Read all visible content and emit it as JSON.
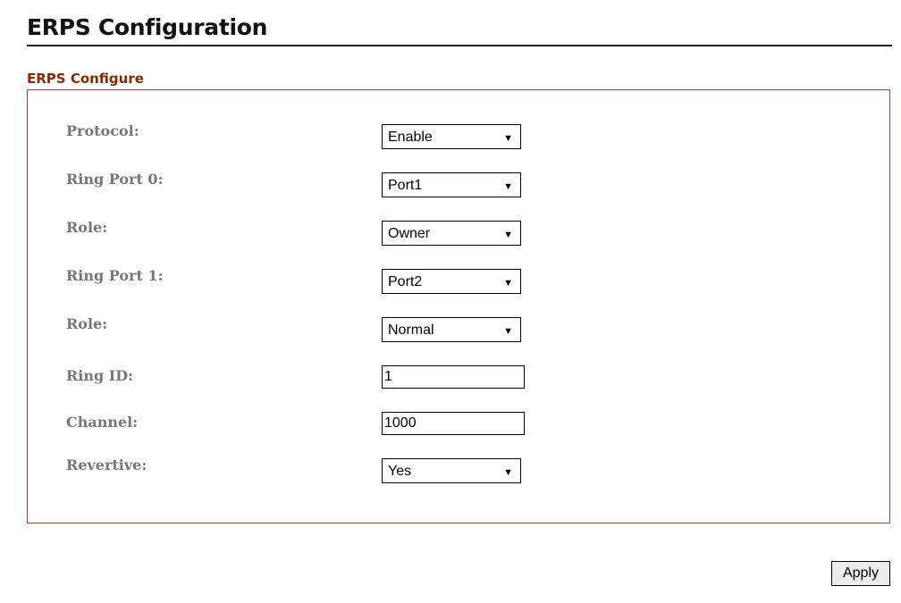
{
  "page": {
    "title": "ERPS Configuration"
  },
  "section": {
    "title": "ERPS Configure"
  },
  "form": {
    "protocol": {
      "label": "Protocol:",
      "value": "Enable",
      "icon": "dropdown-arrow-icon"
    },
    "ring_port_0": {
      "label": "Ring Port 0:",
      "value": "Port1",
      "icon": "dropdown-arrow-icon"
    },
    "role_0": {
      "label": "Role:",
      "value": "Owner",
      "icon": "dropdown-arrow-icon"
    },
    "ring_port_1": {
      "label": "Ring Port 1:",
      "value": "Port2",
      "icon": "dropdown-arrow-icon"
    },
    "role_1": {
      "label": "Role:",
      "value": "Normal",
      "icon": "dropdown-arrow-icon"
    },
    "ring_id": {
      "label": "Ring ID:",
      "value": "1"
    },
    "channel": {
      "label": "Channel:",
      "value": "1000"
    },
    "revertive": {
      "label": "Revertive:",
      "value": "Yes",
      "icon": "dropdown-arrow-icon"
    }
  },
  "actions": {
    "apply_label": "Apply"
  },
  "colors": {
    "section_title": "#8b2a00",
    "box_border": "#c0392b",
    "label_text": "#777777"
  }
}
